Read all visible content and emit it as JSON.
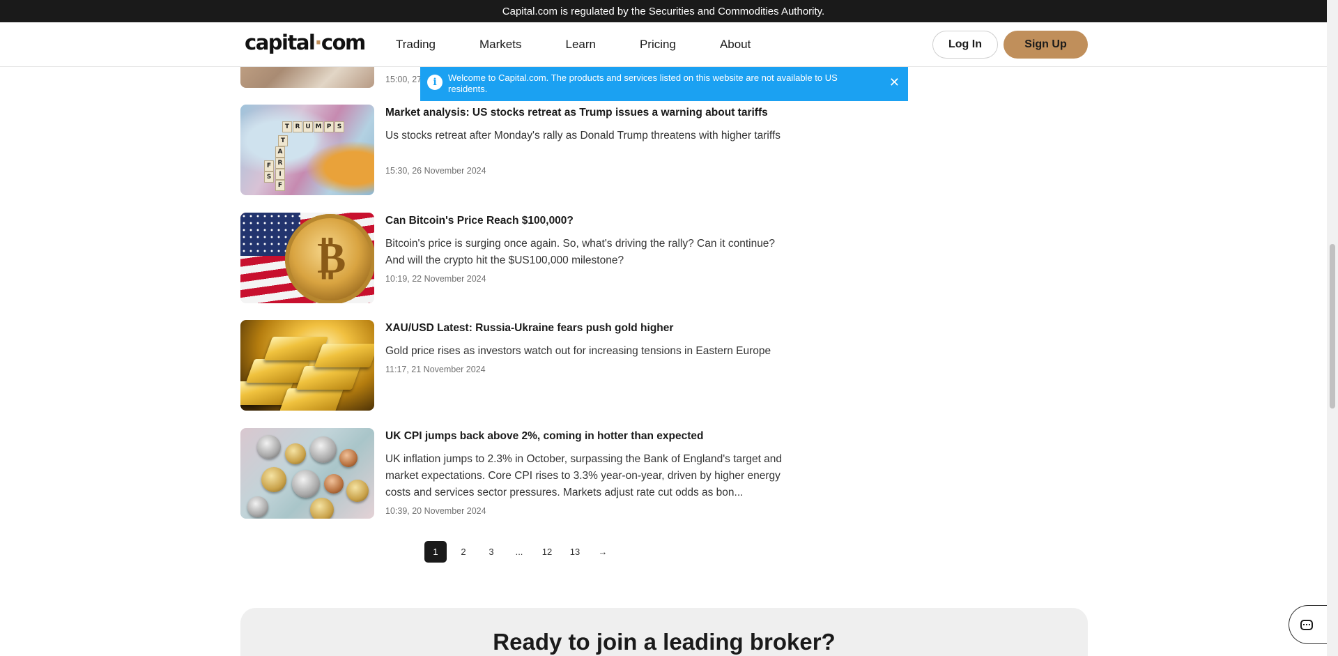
{
  "regulation_bar": {
    "text": "Capital.com is regulated by the Securities and Commodities Authority."
  },
  "header": {
    "logo_word": "capital",
    "logo_dot": "·",
    "logo_suffix": "com",
    "nav": [
      "Trading",
      "Markets",
      "Learn",
      "Pricing",
      "About"
    ],
    "login_label": "Log In",
    "signup_label": "Sign Up",
    "accent_color": "#c08f5b"
  },
  "notification": {
    "icon": "info-icon",
    "icon_glyph": "i",
    "text": "Welcome to Capital.com. The products and services listed on this website are not available to US residents.",
    "close_glyph": "✕",
    "color": "#1ba1f2"
  },
  "articles": [
    {
      "title": "",
      "summary": "",
      "date": "15:00, 27",
      "image": "banknotes-image"
    },
    {
      "title": "Market analysis: US stocks retreat as Trump issues a warning about tariffs",
      "summary": "Us stocks retreat after Monday's rally as Donald Trump threatens with higher tariffs",
      "date": "15:30, 26 November 2024",
      "image": "tariffs-map-image",
      "image_tiles": [
        "T",
        "R",
        "U",
        "M",
        "P",
        "S",
        "T",
        "A",
        "R",
        "I",
        "F",
        "F",
        "S"
      ]
    },
    {
      "title": "Can Bitcoin's Price Reach $100,000?",
      "summary": "Bitcoin's price is surging once again. So, what's driving the rally? Can it continue? And will the crypto hit the $US100,000 milestone?",
      "date": "10:19, 22 November 2024",
      "image": "bitcoin-flag-image",
      "coin_symbol": "₿"
    },
    {
      "title": "XAU/USD Latest: Russia-Ukraine fears push gold higher",
      "summary": "Gold price rises as investors watch out for increasing tensions in Eastern Europe",
      "date": "11:17, 21 November 2024",
      "image": "gold-bars-image"
    },
    {
      "title": "UK CPI jumps back above 2%, coming in hotter than expected",
      "summary": "UK inflation jumps to 2.3% in October, surpassing the Bank of England's target and market expectations. Core CPI rises to 3.3% year-on-year, driven by higher energy costs and services sector pressures. Markets adjust rate cut odds as bon...",
      "date": "10:39, 20 November 2024",
      "image": "uk-coins-image"
    }
  ],
  "pagination": {
    "pages": [
      "1",
      "2",
      "3",
      "...",
      "12",
      "13"
    ],
    "current": "1",
    "next_glyph": "→"
  },
  "cta": {
    "title": "Ready to join a leading broker?"
  },
  "chat": {
    "icon": "chat-icon"
  }
}
